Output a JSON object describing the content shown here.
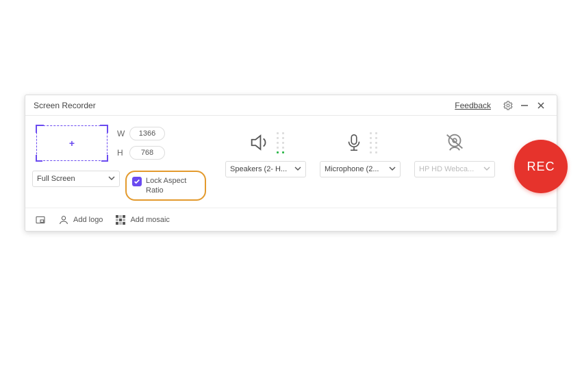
{
  "titlebar": {
    "title": "Screen Recorder",
    "feedback_label": "Feedback"
  },
  "region": {
    "width_label": "W",
    "height_label": "H",
    "width_value": "1366",
    "height_value": "768",
    "mode_selected": "Full Screen",
    "lock_aspect_label": "Lock Aspect Ratio",
    "lock_aspect_checked": true
  },
  "sources": {
    "speaker": {
      "selected": "Speakers (2- H..."
    },
    "microphone": {
      "selected": "Microphone (2..."
    },
    "webcam": {
      "selected": "HP HD Webca...",
      "enabled": false
    }
  },
  "rec_label": "REC",
  "bottombar": {
    "add_logo": "Add logo",
    "add_mosaic": "Add mosaic"
  },
  "icons": {
    "settings": "settings-icon",
    "minimize": "minimize-icon",
    "close": "close-icon",
    "pip": "pip-icon",
    "person": "person-icon",
    "mosaic": "mosaic-icon"
  }
}
